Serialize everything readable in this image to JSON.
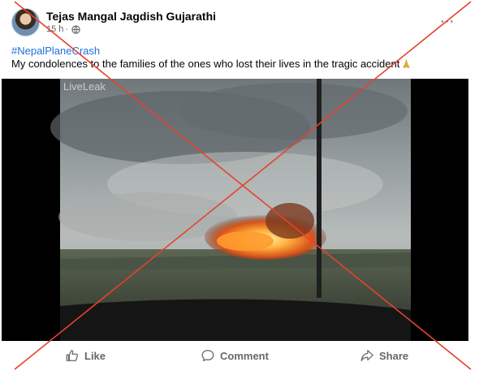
{
  "post": {
    "author": "Tejas Mangal Jagdish Gujarathi",
    "time": "15 h",
    "separator": "·",
    "more": "···",
    "hashtag": "#NepalPlaneCrash",
    "caption": "My condolences to the families of the ones who lost their lives in the tragic accident"
  },
  "media": {
    "watermark": "LiveLeak"
  },
  "actions": {
    "like": "Like",
    "comment": "Comment",
    "share": "Share"
  },
  "icons": {
    "privacy": "globe-icon",
    "emoji": "folded-hands-icon",
    "like": "thumbs-up-icon",
    "comment": "speech-bubble-icon",
    "share": "share-arrow-icon"
  },
  "colors": {
    "hashtag": "#216fdb",
    "muted": "#65676b",
    "cross": "#e8412c"
  }
}
